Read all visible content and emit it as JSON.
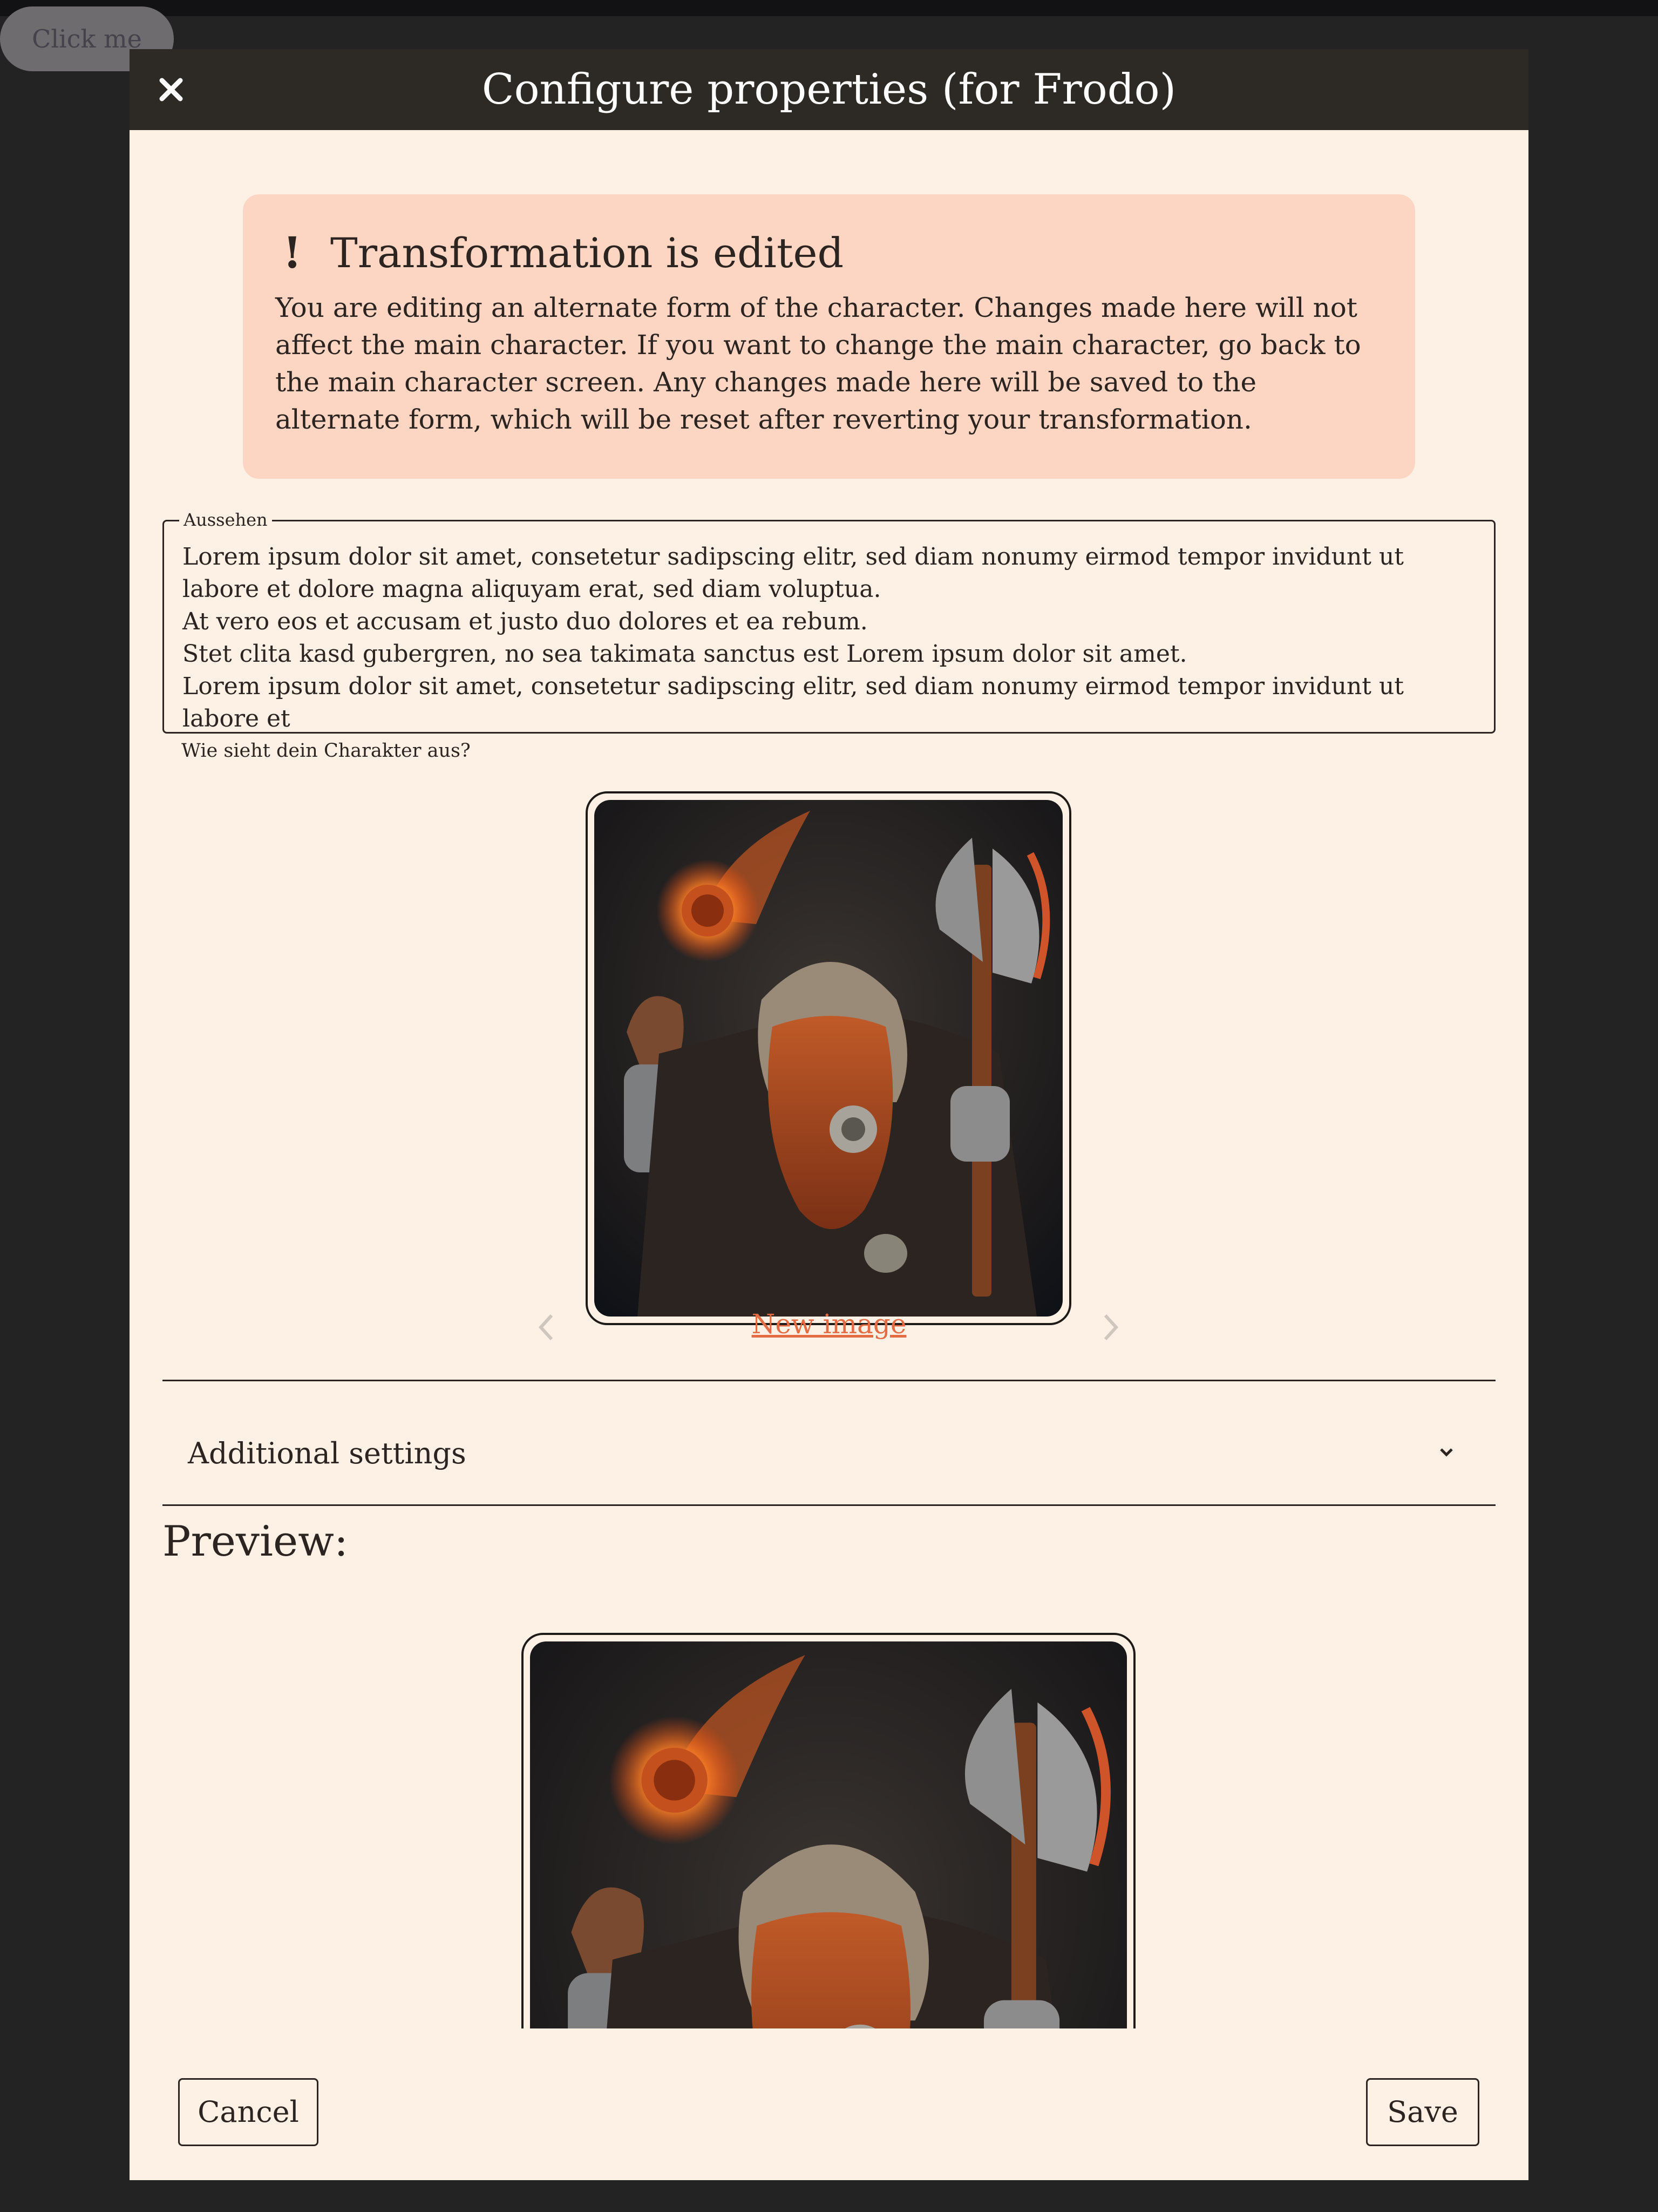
{
  "background_button": {
    "label": "Click me"
  },
  "modal": {
    "title": "Configure properties (for Frodo)",
    "close_icon": "close-icon"
  },
  "alert": {
    "icon": "!",
    "title": "Transformation is edited",
    "body": "You are editing an alternate form of the character. Changes made here will not affect the main character. If you want to change the main character, go back to the main character screen. Any changes made here will be saved to the alternate form, which will be reset after reverting your transformation."
  },
  "appearance_field": {
    "legend": "Aussehen",
    "value": "Lorem ipsum dolor sit amet, consetetur sadipscing elitr, sed diam nonumy eirmod tempor invidunt ut labore et dolore magna aliquyam erat, sed diam voluptua.\nAt vero eos et accusam et justo duo dolores et ea rebum.\nStet clita kasd gubergren, no sea takimata sanctus est Lorem ipsum dolor sit amet.\nLorem ipsum dolor sit amet, consetetur sadipscing elitr, sed diam nonumy eirmod tempor invidunt ut labore et",
    "helper": "Wie sieht dein Charakter aus?"
  },
  "image_picker": {
    "new_image_label": "New image",
    "prev_icon": "chevron-left-icon",
    "next_icon": "chevron-right-icon"
  },
  "additional_settings": {
    "label": "Additional settings",
    "icon": "chevron-down-icon"
  },
  "preview": {
    "label": "Preview:"
  },
  "footer": {
    "cancel_label": "Cancel",
    "save_label": "Save"
  },
  "colors": {
    "accent": "#e36c45",
    "alert_bg": "#fdd6c3",
    "modal_bg": "#fdf0e4",
    "header_bg": "#2d2a26"
  }
}
